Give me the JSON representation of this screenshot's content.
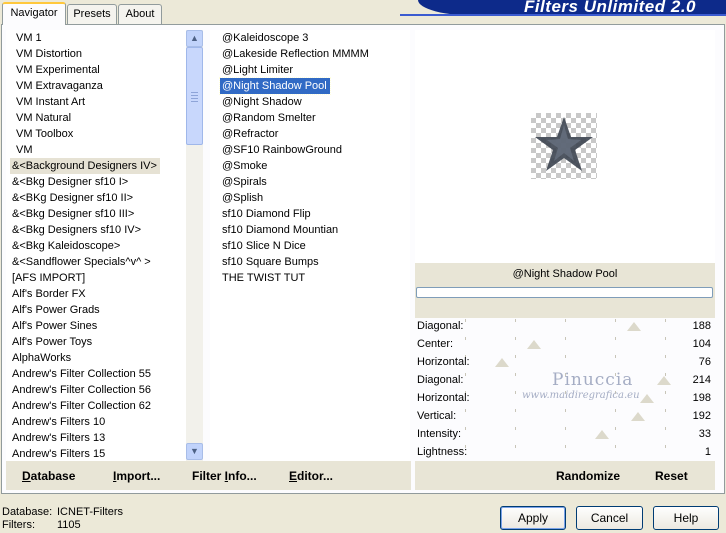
{
  "banner": {
    "title": "Filters Unlimited 2.0"
  },
  "tabs": [
    {
      "label": "Navigator",
      "active": true
    },
    {
      "label": "Presets",
      "active": false
    },
    {
      "label": "About",
      "active": false
    }
  ],
  "categories": {
    "items": [
      "VM 1",
      "VM Distortion",
      "VM Experimental",
      "VM Extravaganza",
      "VM Instant Art",
      "VM Natural",
      "VM Toolbox",
      "VM",
      "&<Background Designers IV>",
      "&<Bkg Designer sf10 I>",
      "&<BKg Designer sf10 II>",
      "&<Bkg Designer sf10 III>",
      "&<Bkg Designers sf10 IV>",
      "&<Bkg Kaleidoscope>",
      "&<Sandflower Specials^v^ >",
      "[AFS IMPORT]",
      "Alf's Border FX",
      "Alf's Power Grads",
      "Alf's Power Sines",
      "Alf's Power Toys",
      "AlphaWorks",
      "Andrew's Filter Collection 55",
      "Andrew's Filter Collection 56",
      "Andrew's Filter Collection 62",
      "Andrew's Filters 10",
      "Andrew's Filters 13",
      "Andrew's Filters 15"
    ],
    "highlighted_index": 8
  },
  "filters": {
    "items": [
      "@Kaleidoscope 3",
      "@Lakeside Reflection MMMM",
      "@Light Limiter",
      "@Night Shadow Pool",
      "@Night Shadow",
      "@Random Smelter",
      "@Refractor",
      "@SF10 RainbowGround",
      "@Smoke",
      "@Spirals",
      "@Splish",
      "sf10 Diamond Flip",
      "sf10 Diamond Mountian",
      "sf10 Slice N Dice",
      "sf10 Square Bumps",
      "THE TWIST TUT"
    ],
    "selected_index": 3
  },
  "left_buttons": {
    "database": "Database",
    "import": "Import...",
    "filter_info": "Filter Info...",
    "editor": "Editor..."
  },
  "preview": {
    "filter_name": "@Night Shadow Pool",
    "progress": 0
  },
  "parameters": [
    {
      "label": "Diagonal:",
      "value": "188"
    },
    {
      "label": "Center:",
      "value": "104"
    },
    {
      "label": "Horizontal:",
      "value": "76"
    },
    {
      "label": "Diagonal:",
      "value": "214"
    },
    {
      "label": "Horizontal:",
      "value": "198"
    },
    {
      "label": "Vertical:",
      "value": "192"
    },
    {
      "label": "Intensity:",
      "value": "33"
    },
    {
      "label": "Lightness:",
      "value": "1"
    }
  ],
  "right_buttons": {
    "randomize": "Randomize",
    "reset": "Reset"
  },
  "status": {
    "database_label": "Database:",
    "database_value": "ICNET-Filters",
    "filters_label": "Filters:",
    "filters_value": "1105"
  },
  "dialog_buttons": {
    "apply": "Apply",
    "cancel": "Cancel",
    "help": "Help"
  },
  "watermark": {
    "name": "Pinuccia",
    "url": "www.maidiregrafica.eu"
  }
}
